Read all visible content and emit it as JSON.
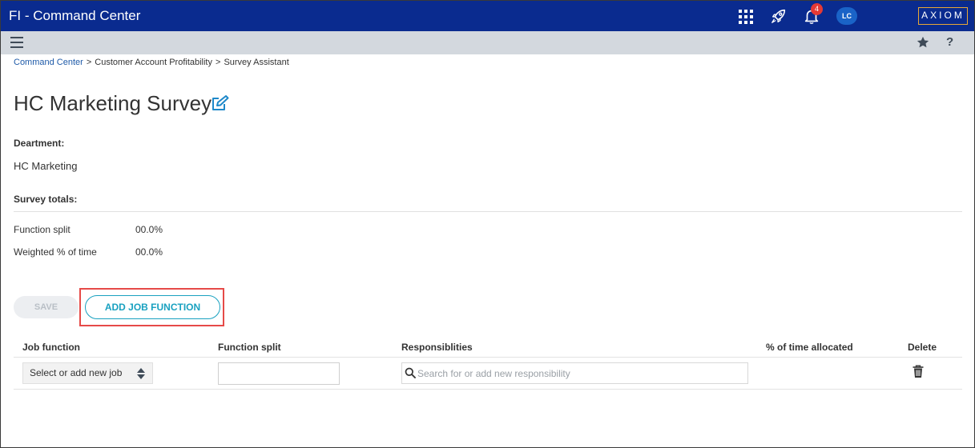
{
  "app": {
    "title": "FI - Command Center",
    "notification_count": "4",
    "user_initials": "LC",
    "logo_text": "AXIOM"
  },
  "subbar": {
    "help_label": "?"
  },
  "breadcrumb": {
    "items": [
      "Command Center",
      "Customer Account Profitability",
      "Survey Assistant"
    ],
    "separator": ">"
  },
  "page": {
    "title": "HC Marketing Survey"
  },
  "department": {
    "label": "Deartment:",
    "value": "HC Marketing"
  },
  "totals": {
    "label": "Survey totals:",
    "function_split_label": "Function split",
    "function_split_value": "00.0%",
    "weighted_label": "Weighted % of time",
    "weighted_value": "00.0%"
  },
  "actions": {
    "save_label": "SAVE",
    "add_job_function_label": "ADD JOB FUNCTION"
  },
  "table": {
    "columns": [
      "Job function",
      "Function split",
      "Responsiblities",
      "% of time allocated",
      "Delete"
    ],
    "row": {
      "job_select_value": "Select or add new job",
      "function_split_value": "",
      "responsibility_placeholder": "Search for or add new responsibility"
    }
  },
  "colors": {
    "topbar": "#0a2b8f",
    "subbar": "#d3d8de",
    "accent": "#19a1c0",
    "highlight": "#e64a48",
    "badge": "#e53935",
    "logo_border": "#e8a736",
    "link": "#1e5aa8"
  },
  "icons": {
    "apps": "apps-grid-icon",
    "launch": "rocket-icon",
    "notifications": "bell-icon",
    "menu": "hamburger-menu-icon",
    "favorite": "star-icon",
    "help": "help-icon",
    "edit": "edit-icon",
    "select": "sort-arrows-icon",
    "search": "search-icon",
    "delete": "trash-icon"
  }
}
